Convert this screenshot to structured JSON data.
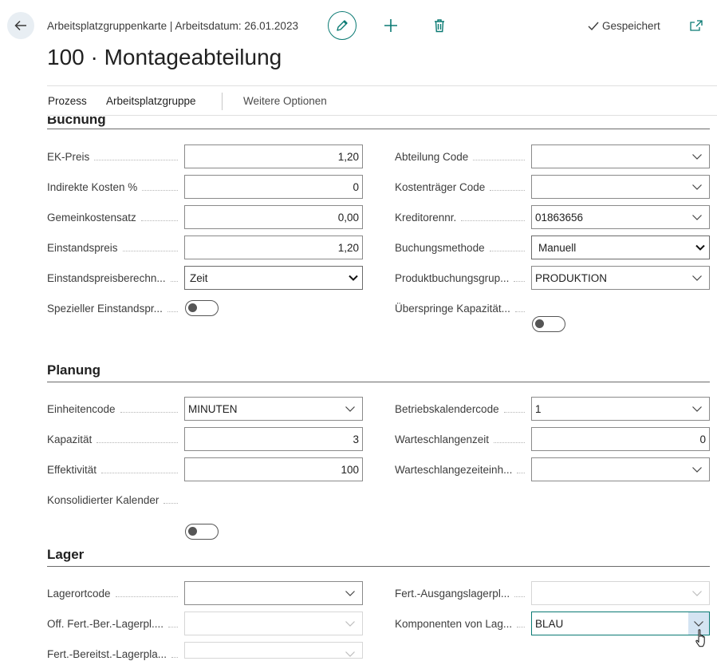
{
  "header": {
    "breadcrumb": "Arbeitsplatzgruppenkarte | Arbeitsdatum: 26.01.2023",
    "saved_label": "Gespeichert",
    "title": "100 · Montageabteilung"
  },
  "actions": [
    {
      "label": "Prozess"
    },
    {
      "label": "Arbeitsplatzgruppe"
    },
    {
      "label": "Weitere Optionen"
    }
  ],
  "sections": {
    "buchung": {
      "title": "Buchung",
      "left": [
        {
          "label": "EK-Preis",
          "value": "1,20"
        },
        {
          "label": "Indirekte Kosten %",
          "value": "0"
        },
        {
          "label": "Gemeinkostensatz",
          "value": "0,00"
        },
        {
          "label": "Einstandspreis",
          "value": "1,20"
        },
        {
          "label": "Einstandspreisberechn...",
          "value": "Zeit"
        },
        {
          "label": "Spezieller Einstandspr...",
          "value": "off"
        }
      ],
      "right": [
        {
          "label": "Abteilung Code",
          "value": ""
        },
        {
          "label": "Kostenträger Code",
          "value": ""
        },
        {
          "label": "Kreditorennr.",
          "value": "01863656"
        },
        {
          "label": "Buchungsmethode",
          "value": "Manuell"
        },
        {
          "label": "Produktbuchungsgrup...",
          "value": "PRODUKTION"
        },
        {
          "label": "Überspringe Kapazität...",
          "value": "off"
        }
      ]
    },
    "planung": {
      "title": "Planung",
      "left": [
        {
          "label": "Einheitencode",
          "value": "MINUTEN"
        },
        {
          "label": "Kapazität",
          "value": "3"
        },
        {
          "label": "Effektivität",
          "value": "100"
        },
        {
          "label": "Konsolidierter Kalender",
          "value": "off"
        }
      ],
      "right": [
        {
          "label": "Betriebskalendercode",
          "value": "1"
        },
        {
          "label": "Warteschlangenzeit",
          "value": "0"
        },
        {
          "label": "Warteschlangezeiteinh...",
          "value": ""
        }
      ]
    },
    "lager": {
      "title": "Lager",
      "left": [
        {
          "label": "Lagerortcode",
          "value": ""
        },
        {
          "label": "Off. Fert.-Ber.-Lagerpl....",
          "value": ""
        },
        {
          "label": "Fert.-Bereitst.-Lagerpla...",
          "value": ""
        }
      ],
      "right": [
        {
          "label": "Fert.-Ausgangslagerpl...",
          "value": ""
        },
        {
          "label": "Komponenten von Lag...",
          "value": "BLAU"
        }
      ]
    }
  },
  "icons": {
    "back": "arrow-left-icon",
    "edit": "pencil-icon",
    "new": "plus-icon",
    "delete": "trash-icon",
    "saved": "checkmark-icon",
    "share": "share-icon",
    "dropdown": "chevron-down-icon"
  },
  "colors": {
    "accent": "#0a7a73",
    "back_button_bg": "#e8eef3",
    "dropdown_hover": "#d4e4f2"
  }
}
